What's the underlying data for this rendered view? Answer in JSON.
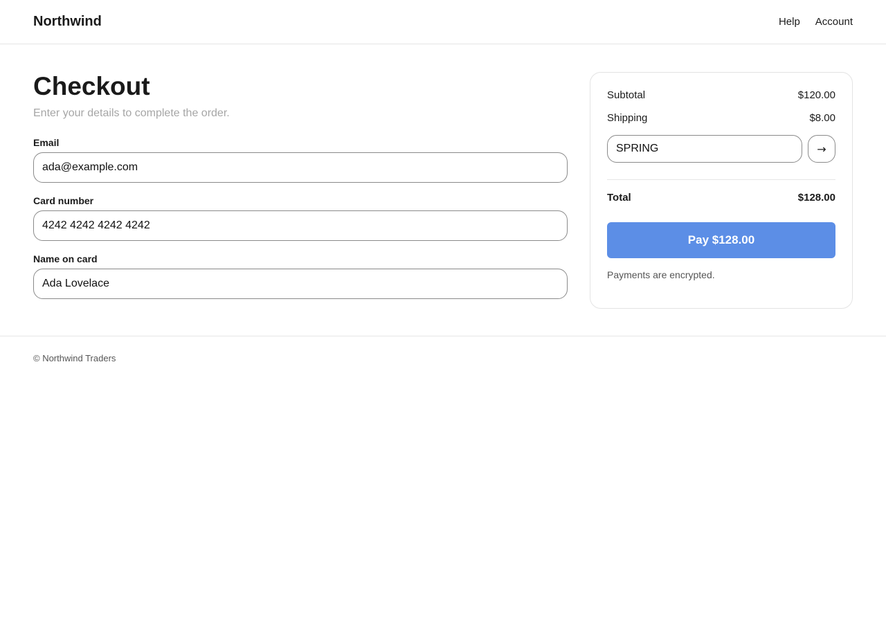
{
  "header": {
    "brand": "Northwind",
    "nav": [
      {
        "label": "Help"
      },
      {
        "label": "Account"
      }
    ]
  },
  "checkout": {
    "title": "Checkout",
    "subtitle": "Enter your details to complete the order.",
    "fields": {
      "email": {
        "label": "Email",
        "value": "ada@example.com"
      },
      "card_number": {
        "label": "Card number",
        "value": "4242 4242 4242 4242"
      },
      "name_on_card": {
        "label": "Name on card",
        "value": "Ada Lovelace"
      }
    }
  },
  "summary": {
    "subtotal_label": "Subtotal",
    "subtotal_value": "$120.00",
    "shipping_label": "Shipping",
    "shipping_value": "$8.00",
    "promo_code": "SPRING",
    "promo_apply_icon": "→",
    "total_label": "Total",
    "total_value": "$128.00",
    "pay_label": "Pay $128.00",
    "note": "Payments are encrypted."
  },
  "footer": {
    "text": "© Northwind Traders"
  },
  "colors": {
    "accent": "#5c8ee6",
    "border": "#e6e6e6",
    "muted_text": "#a6a6a6"
  },
  "icons": {
    "promo_apply": "arrow-right-icon"
  }
}
